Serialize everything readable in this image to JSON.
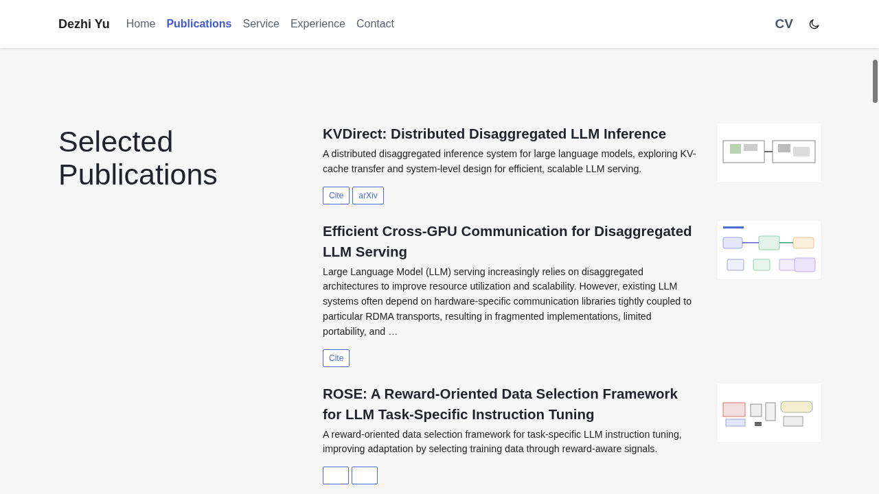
{
  "navbar": {
    "brand": "Dezhi Yu",
    "links": [
      {
        "label": "Home",
        "selected": false
      },
      {
        "label": "Publications",
        "selected": true
      },
      {
        "label": "Service",
        "selected": false
      },
      {
        "label": "Experience",
        "selected": false
      },
      {
        "label": "Contact",
        "selected": false
      }
    ],
    "cv": "CV"
  },
  "section": {
    "title": "Selected Publications"
  },
  "publications": [
    {
      "title": "KVDirect: Distributed Disaggregated LLM Inference",
      "summary": "A distributed disaggregated inference system for large language models, exploring KV-cache transfer and system-level design for efficient, scalable LLM serving.",
      "buttons": [
        {
          "label": "Cite"
        },
        {
          "label": "arXiv"
        }
      ],
      "thumbnail": {
        "kind": "picture"
      }
    },
    {
      "title": "Efficient Cross-GPU Communication for Disaggregated LLM Serving",
      "summary": "Large Language Model (LLM) serving increasingly relies on disaggregated architectures to improve resource utilization and scalability. However, existing LLM systems often depend on hardware-specific communication libraries tightly coupled to particular RDMA transports, resulting in fragmented implementations, limited portability, and …",
      "buttons": [
        {
          "label": "Cite"
        }
      ],
      "thumbnail": {
        "kind": "picture"
      }
    },
    {
      "title": "ROSE: A Reward-Oriented Data Selection Framework for LLM Task-Specific Instruction Tuning",
      "summary": "A reward-oriented data selection framework for task-specific LLM instruction tuning, improving adaptation by selecting training data through reward-aware signals.",
      "buttons": [
        {
          "kind": "cut"
        },
        {
          "kind": "cut"
        }
      ],
      "thumbnail": {
        "kind": "picture"
      }
    }
  ]
}
